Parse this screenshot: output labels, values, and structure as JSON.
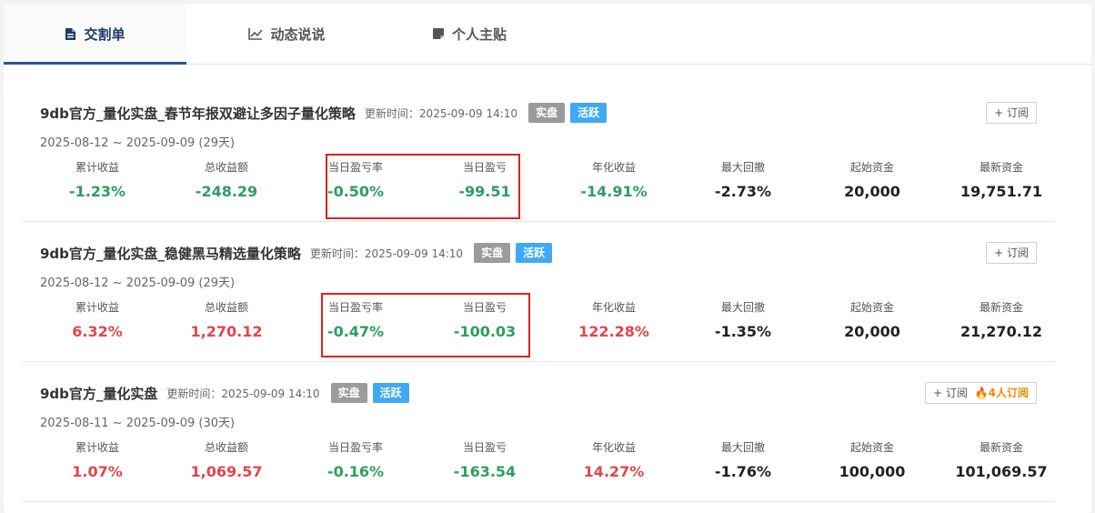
{
  "tabs": [
    {
      "label": "交割单",
      "icon": "document-icon",
      "active": true
    },
    {
      "label": "动态说说",
      "icon": "chart-line-icon",
      "active": false
    },
    {
      "label": "个人主贴",
      "icon": "note-icon",
      "active": false
    }
  ],
  "strategies": [
    {
      "title": "9db官方_量化实盘_春节年报双避让多因子量化策略",
      "updated": "更新时间：2025-09-09 14:10",
      "badges": [
        "实盘",
        "活跃"
      ],
      "subscribe_label": "+ 订阅",
      "subscriber_count": "",
      "date_range": "2025-08-12 ~ 2025-09-09 (29天)",
      "stats": [
        {
          "label": "累计收益",
          "value": "-1.23%",
          "color": "green"
        },
        {
          "label": "总收益额",
          "value": "-248.29",
          "color": "green"
        },
        {
          "label": "当日盈亏率",
          "value": "-0.50%",
          "color": "green"
        },
        {
          "label": "当日盈亏",
          "value": "-99.51",
          "color": "green"
        },
        {
          "label": "年化收益",
          "value": "-14.91%",
          "color": "green"
        },
        {
          "label": "最大回撤",
          "value": "-2.73%",
          "color": "black"
        },
        {
          "label": "起始资金",
          "value": "20,000",
          "color": "black"
        },
        {
          "label": "最新资金",
          "value": "19,751.71",
          "color": "black"
        }
      ]
    },
    {
      "title": "9db官方_量化实盘_稳健黑马精选量化策略",
      "updated": "更新时间：2025-09-09 14:10",
      "badges": [
        "实盘",
        "活跃"
      ],
      "subscribe_label": "+ 订阅",
      "subscriber_count": "",
      "date_range": "2025-08-12 ~ 2025-09-09 (29天)",
      "stats": [
        {
          "label": "累计收益",
          "value": "6.32%",
          "color": "red"
        },
        {
          "label": "总收益额",
          "value": "1,270.12",
          "color": "red"
        },
        {
          "label": "当日盈亏率",
          "value": "-0.47%",
          "color": "green"
        },
        {
          "label": "当日盈亏",
          "value": "-100.03",
          "color": "green"
        },
        {
          "label": "年化收益",
          "value": "122.28%",
          "color": "red"
        },
        {
          "label": "最大回撤",
          "value": "-1.35%",
          "color": "black"
        },
        {
          "label": "起始资金",
          "value": "20,000",
          "color": "black"
        },
        {
          "label": "最新资金",
          "value": "21,270.12",
          "color": "black"
        }
      ]
    },
    {
      "title": "9db官方_量化实盘",
      "updated": "更新时间：2025-09-09 14:10",
      "badges": [
        "实盘",
        "活跃"
      ],
      "subscribe_label": "+ 订阅",
      "subscriber_count": "4人订阅",
      "date_range": "2025-08-11 ~ 2025-09-09 (30天)",
      "stats": [
        {
          "label": "累计收益",
          "value": "1.07%",
          "color": "red"
        },
        {
          "label": "总收益额",
          "value": "1,069.57",
          "color": "red"
        },
        {
          "label": "当日盈亏率",
          "value": "-0.16%",
          "color": "green"
        },
        {
          "label": "当日盈亏",
          "value": "-163.54",
          "color": "green"
        },
        {
          "label": "年化收益",
          "value": "14.27%",
          "color": "red"
        },
        {
          "label": "最大回撤",
          "value": "-1.76%",
          "color": "black"
        },
        {
          "label": "起始资金",
          "value": "100,000",
          "color": "black"
        },
        {
          "label": "最新资金",
          "value": "101,069.57",
          "color": "black"
        }
      ]
    }
  ],
  "colors": {
    "red": "#e0464d",
    "green": "#2e9d5f",
    "black": "#222222",
    "accent": "#2f5597",
    "highlight_box": "#e02020"
  }
}
